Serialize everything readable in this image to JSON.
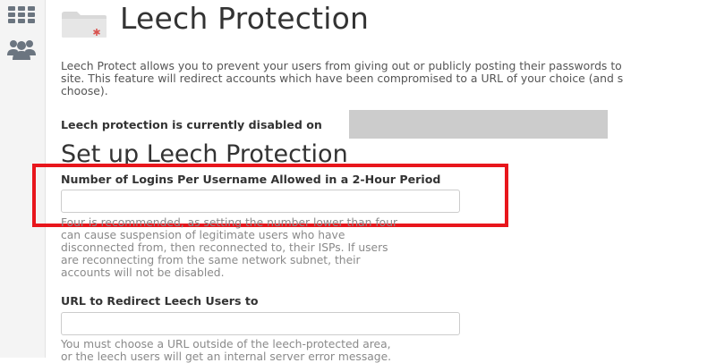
{
  "sidebar": {
    "icons": [
      "grid-icon",
      "users-icon"
    ]
  },
  "header": {
    "title": "Leech Protection",
    "icon": "folder-icon",
    "icon_badge_color": "#d9534f"
  },
  "intro": {
    "lines": [
      "Leech Protect allows you to prevent your users from giving out or publicly posting their passwords to",
      "site. This feature will redirect accounts which have been compromised to a URL of your choice (and s",
      "choose)."
    ]
  },
  "status": {
    "text": "Leech protection is currently disabled on"
  },
  "setup": {
    "title": "Set up Leech Protection",
    "logins": {
      "label": "Number of Logins Per Username Allowed in a 2-Hour Period",
      "value": "",
      "help_lines": [
        "Four is recommended, as setting the number lower than four",
        "can cause suspension of legitimate users who have",
        "disconnected from, then reconnected to, their ISPs. If users",
        "are reconnecting from the same network subnet, their",
        "accounts will not be disabled."
      ]
    },
    "redirect": {
      "label": "URL to Redirect Leech Users to",
      "value": "",
      "help_lines": [
        "You must choose a URL outside of the leech-protected area,",
        "or the leech users will get an internal server error message."
      ]
    }
  },
  "colors": {
    "highlight": "#e8161c",
    "sidebar_bg": "#f4f4f4",
    "icon": "#6b7580"
  }
}
